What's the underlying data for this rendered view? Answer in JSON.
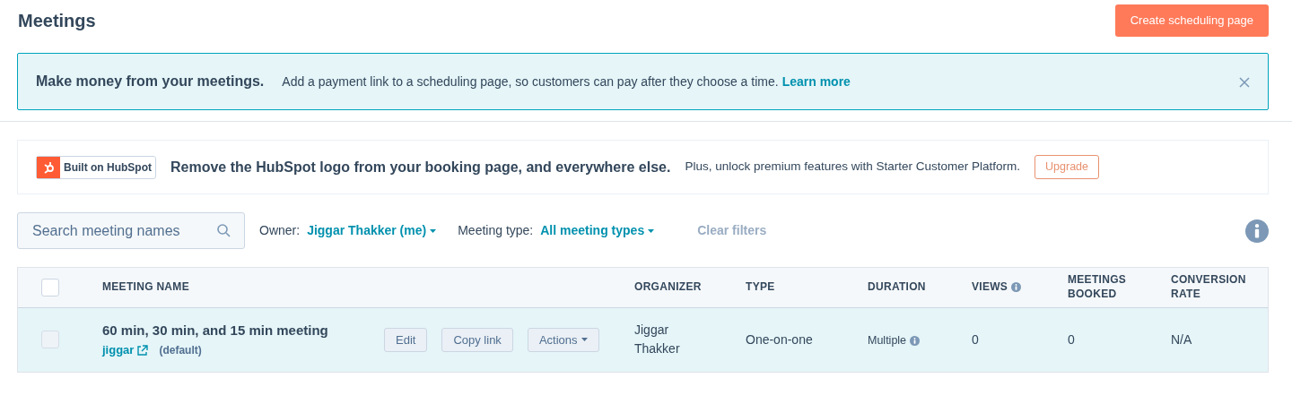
{
  "page": {
    "title": "Meetings",
    "primary_button": "Create scheduling page"
  },
  "alert": {
    "title": "Make money from your meetings.",
    "text": "Add a payment link to a scheduling page, so customers can pay after they choose a time.",
    "link": "Learn more"
  },
  "promo": {
    "badge": "Built on HubSpot",
    "headline": "Remove the HubSpot logo from your booking page, and everywhere else.",
    "text": "Plus, unlock premium features with Starter Customer Platform.",
    "button": "Upgrade"
  },
  "filters": {
    "search": {
      "placeholder": "Search meeting names"
    },
    "owner_label": "Owner:",
    "owner_value": "Jiggar Thakker (me)",
    "type_label": "Meeting type:",
    "type_value": "All meeting types",
    "clear": "Clear filters"
  },
  "table": {
    "select_all_checked": false,
    "columns": [
      {
        "label": "MEETING NAME",
        "info": false
      },
      {
        "label": "ORGANIZER",
        "info": false
      },
      {
        "label": "TYPE",
        "info": false
      },
      {
        "label": "DURATION",
        "info": false
      },
      {
        "label": "VIEWS",
        "info": true
      },
      {
        "label": "MEETINGS BOOKED",
        "info": false
      },
      {
        "label": "CONVERSION RATE",
        "info": false
      }
    ],
    "rows": [
      {
        "checked": false,
        "selected": true,
        "name": "60 min, 30 min, and 15 min meeting",
        "link": "jiggar",
        "tag": "(default)",
        "actions": [
          "Edit",
          "Copy link",
          "Actions"
        ],
        "organizer": "Jiggar Thakker",
        "type": "One-on-one",
        "duration": "Multiple",
        "views": "0",
        "booked": "0",
        "conversion": "N/A"
      }
    ]
  }
}
